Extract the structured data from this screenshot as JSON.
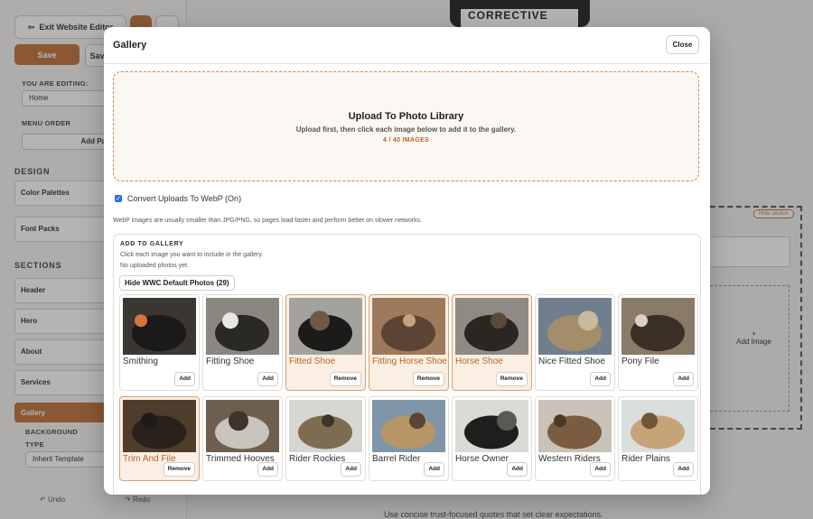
{
  "editor": {
    "exit_label": "Exit Website Editor",
    "save_label": "Save",
    "save2_label": "Save",
    "you_are_editing_label": "YOU ARE EDITING:",
    "editing_value": "Home",
    "menu_order_label": "MENU ORDER",
    "add_page_label": "Add Pa",
    "design_heading": "DESIGN",
    "color_palettes": "Color Palettes",
    "font_packs": "Font Packs",
    "sections_heading": "SECTIONS",
    "sections": [
      "Header",
      "Hero",
      "About",
      "Services"
    ],
    "gallery_label": "Gallery",
    "background_label": "BACKGROUND",
    "type_label": "TYPE",
    "type_value": "Inherit Template",
    "undo_label": "Undo",
    "redo_label": "Redo",
    "canvas_badge": "CORRECTIVE",
    "hide_section_label": "Hide section",
    "add_image_label": "Add Image",
    "bottom_quote": "Use concise trust-focused quotes that set clear expectations."
  },
  "modal": {
    "title": "Gallery",
    "close_label": "Close",
    "upload": {
      "title": "Upload To Photo Library",
      "subtitle": "Upload first, then click each image below to add it to the gallery.",
      "count": "4 / 40 IMAGES"
    },
    "webp_label": "Convert Uploads To WebP (On)",
    "webp_checked": true,
    "webp_note": "WebP images are usually smaller than JPG/PNG, so pages load faster and perform better on slower networks.",
    "add_to_gallery": {
      "title": "ADD TO GALLERY",
      "subtitle": "Click each image you want to include in the gallery.",
      "none_text": "No uploaded photos yet.",
      "hide_button": "Hide WWC Default Photos (29)"
    },
    "photos": [
      {
        "name": "Smithing",
        "action": "Add",
        "selected": false
      },
      {
        "name": "Fitting Shoe",
        "action": "Add",
        "selected": false
      },
      {
        "name": "Fitted Shoe",
        "action": "Remove",
        "selected": true
      },
      {
        "name": "Fitting Horse Shoe",
        "action": "Remove",
        "selected": true
      },
      {
        "name": "Horse Shoe",
        "action": "Remove",
        "selected": true
      },
      {
        "name": "Nice Fitted Shoe",
        "action": "Add",
        "selected": false
      },
      {
        "name": "Pony File",
        "action": "Add",
        "selected": false
      },
      {
        "name": "Trim And File",
        "action": "Remove",
        "selected": true
      },
      {
        "name": "Trimmed Hooves",
        "action": "Add",
        "selected": false
      },
      {
        "name": "Rider Rockies",
        "action": "Add",
        "selected": false
      },
      {
        "name": "Barrel Rider",
        "action": "Add",
        "selected": false
      },
      {
        "name": "Horse Owner",
        "action": "Add",
        "selected": false
      },
      {
        "name": "Western Riders",
        "action": "Add",
        "selected": false
      },
      {
        "name": "Rider Plains",
        "action": "Add",
        "selected": false
      }
    ]
  },
  "colors": {
    "accent": "#c1723a",
    "selected_bg": "#fbeee2",
    "checkbox": "#2f6fd6"
  }
}
